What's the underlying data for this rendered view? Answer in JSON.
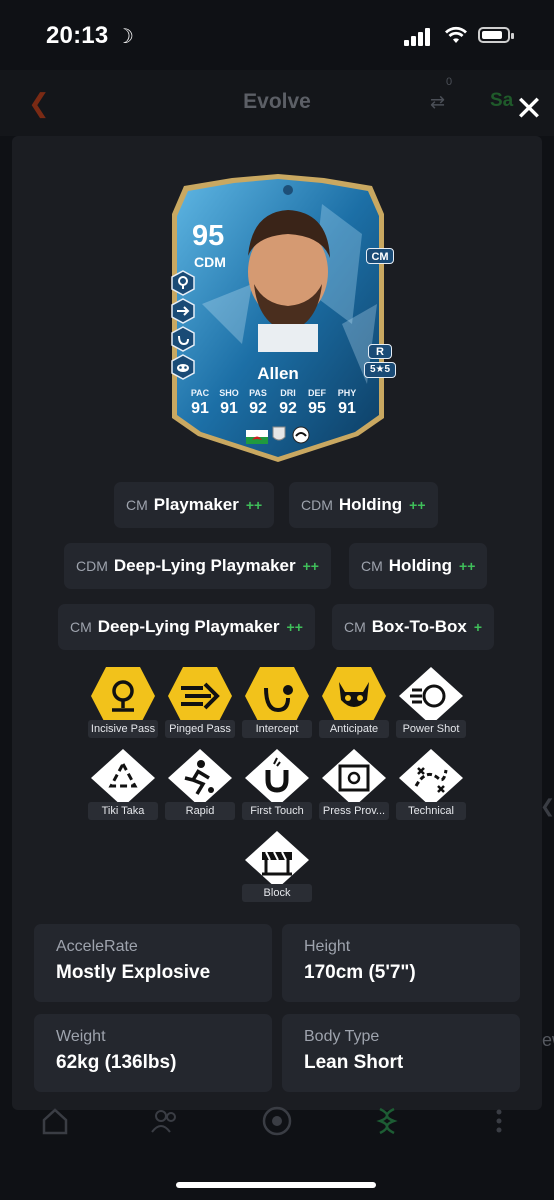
{
  "status_bar": {
    "time": "20:13",
    "moon_icon": "moon-icon"
  },
  "header": {
    "title": "Evolve",
    "compare_count": "0",
    "save_label": "Sa"
  },
  "card": {
    "rating": "95",
    "position": "CDM",
    "alt_position": "CM",
    "foot": "R",
    "skills_weakfoot": "5★5",
    "name": "Allen",
    "stats": [
      {
        "label": "PAC",
        "value": "91"
      },
      {
        "label": "SHO",
        "value": "91"
      },
      {
        "label": "PAS",
        "value": "92"
      },
      {
        "label": "DRI",
        "value": "92"
      },
      {
        "label": "DEF",
        "value": "95"
      },
      {
        "label": "PHY",
        "value": "91"
      }
    ]
  },
  "roles": [
    {
      "pos": "CM",
      "name": "Playmaker",
      "plus": "++"
    },
    {
      "pos": "CDM",
      "name": "Holding",
      "plus": "++"
    },
    {
      "pos": "CDM",
      "name": "Deep-Lying Playmaker",
      "plus": "++"
    },
    {
      "pos": "CM",
      "name": "Holding",
      "plus": "++"
    },
    {
      "pos": "CM",
      "name": "Deep-Lying Playmaker",
      "plus": "++"
    },
    {
      "pos": "CM",
      "name": "Box-To-Box",
      "plus": "+"
    }
  ],
  "playstyles": [
    {
      "label": "Incisive Pass",
      "plus": true,
      "icon": "pin-icon"
    },
    {
      "label": "Pinged Pass",
      "plus": true,
      "icon": "arrow-icon"
    },
    {
      "label": "Intercept",
      "plus": true,
      "icon": "hook-icon"
    },
    {
      "label": "Anticipate",
      "plus": true,
      "icon": "raccoon-icon"
    },
    {
      "label": "Power Shot",
      "plus": false,
      "icon": "ball-icon"
    },
    {
      "label": "Tiki Taka",
      "plus": false,
      "icon": "triangle-arrows-icon"
    },
    {
      "label": "Rapid",
      "plus": false,
      "icon": "runner-icon"
    },
    {
      "label": "First Touch",
      "plus": false,
      "icon": "magnet-icon"
    },
    {
      "label": "Press Prov...",
      "plus": false,
      "icon": "safe-icon"
    },
    {
      "label": "Technical",
      "plus": false,
      "icon": "tactics-icon"
    },
    {
      "label": "Block",
      "plus": false,
      "icon": "barrier-icon"
    }
  ],
  "info": [
    {
      "key": "AcceleRate",
      "value": "Mostly Explosive"
    },
    {
      "key": "Height",
      "value": "170cm (5'7\")"
    },
    {
      "key": "Weight",
      "value": "62kg (136lbs)"
    },
    {
      "key": "Body Type",
      "value": "Lean Short"
    }
  ],
  "colors": {
    "gold": "#f2c21b",
    "plus_green": "#3fbf5a",
    "panel": "#1b1d22",
    "chip": "#24272e"
  }
}
